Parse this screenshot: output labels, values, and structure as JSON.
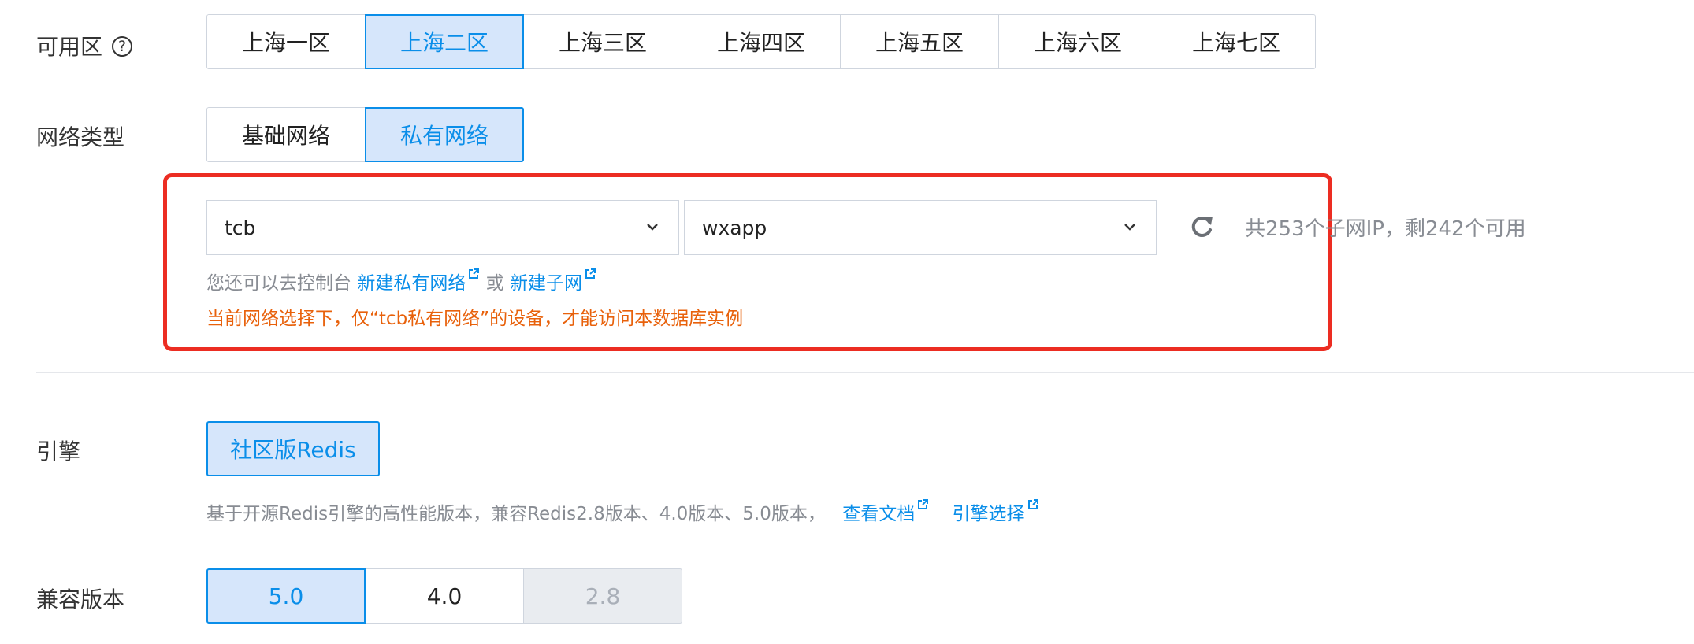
{
  "zone": {
    "label": "可用区",
    "help_icon": "?",
    "options": [
      "上海一区",
      "上海二区",
      "上海三区",
      "上海四区",
      "上海五区",
      "上海六区",
      "上海七区"
    ],
    "selected": "上海二区"
  },
  "network_type": {
    "label": "网络类型",
    "options": [
      "基础网络",
      "私有网络"
    ],
    "selected": "私有网络",
    "vpc_select": {
      "value": "tcb",
      "icon": "chevron-down-icon"
    },
    "subnet_select": {
      "value": "wxapp",
      "icon": "chevron-down-icon"
    },
    "refresh_icon": "refresh-icon",
    "subnet_info": "共253个子网IP，剩242个可用",
    "hint_prefix": "您还可以去控制台",
    "create_vpc_link": "新建私有网络",
    "or_text": "或",
    "create_subnet_link": "新建子网",
    "warning": "当前网络选择下，仅“tcb私有网络”的设备，才能访问本数据库实例",
    "highlight_color": "#ec2d22"
  },
  "engine": {
    "label": "引擎",
    "options": [
      "社区版Redis"
    ],
    "selected": "社区版Redis",
    "description": "基于开源Redis引擎的高性能版本，兼容Redis2.8版本、4.0版本、5.0版本，",
    "docs_link": "查看文档",
    "engine_choice_link": "引擎选择"
  },
  "version": {
    "label": "兼容版本",
    "options": [
      "5.0",
      "4.0",
      "2.8"
    ],
    "selected": "5.0",
    "disabled": [
      "2.8"
    ]
  },
  "colors": {
    "accent": "#0a8ee9",
    "selected_bg": "#d6e6fb",
    "warning": "#e8610b",
    "muted_text": "#888c93"
  }
}
